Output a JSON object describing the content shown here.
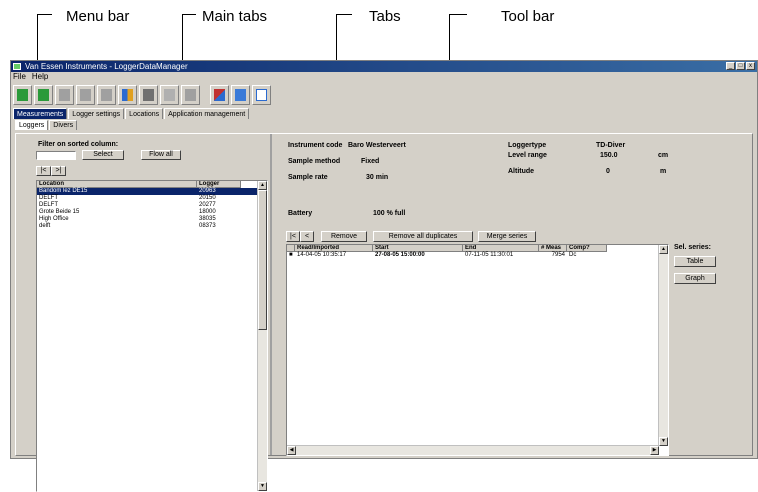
{
  "annotations": {
    "menu_bar": "Menu bar",
    "main_tabs": "Main tabs",
    "tabs": "Tabs",
    "tool_bar": "Tool bar"
  },
  "window": {
    "title": "Van Essen Instruments - LoggerDataManager",
    "min": "_",
    "max": "□",
    "close": "x"
  },
  "menu": {
    "items": [
      "File",
      "Help"
    ]
  },
  "toolbar": {
    "buttons": [
      {
        "icon": "connect-logger-icon",
        "color": "#2a9a3a"
      },
      {
        "icon": "logger-settings-icon",
        "color": "#2a9a3a"
      },
      {
        "icon": "chart-icon",
        "color": "#808080"
      },
      {
        "icon": "graph-icon",
        "color": "#808080"
      },
      {
        "icon": "compensate-icon",
        "color": "#808080"
      },
      {
        "icon": "export-icon",
        "color": "#2a6ad0"
      },
      {
        "icon": "table-icon",
        "color": "#606060"
      },
      {
        "icon": "thermometer-icon",
        "color": "#808080"
      },
      {
        "icon": "network-icon",
        "color": "#808080"
      },
      {
        "icon": "report-icon",
        "color": "#c03030"
      },
      {
        "icon": "list-icon",
        "color": "#2a6ad0"
      },
      {
        "icon": "calendar-icon",
        "color": "#2a6ad0"
      }
    ]
  },
  "main_tabs": [
    "Measurements",
    "Logger settings",
    "Locations",
    "Application management"
  ],
  "sub_tabs": [
    "Loggers",
    "Divers"
  ],
  "left": {
    "filter_label": "Filter on sorted column:",
    "select": "Select",
    "flow_all": "Flow all",
    "nav_first": "|<",
    "nav_next": ">|",
    "columns": [
      "Location",
      "Logger"
    ],
    "rows": [
      {
        "location": "Bandom lez DE15",
        "logger": "20963"
      },
      {
        "location": "DELFT",
        "logger": "20150"
      },
      {
        "location": "DELFT",
        "logger": "20277"
      },
      {
        "location": "Grote Beide 15",
        "logger": "18000"
      },
      {
        "location": "High Office",
        "logger": "38035"
      },
      {
        "location": "delft",
        "logger": "08373"
      }
    ]
  },
  "right": {
    "instrument_code_label": "Instrument code",
    "instrument_code": "Baro Westerveert",
    "logger_type_label": "Loggertype",
    "logger_type": "TD-Diver",
    "sample_method_label": "Sample method",
    "sample_method": "Fixed",
    "level_range_label": "Level range",
    "level_range": "150.0",
    "level_unit": "cm",
    "sample_rate_label": "Sample rate",
    "sample_rate": "30 min",
    "altitude_label": "Altitude",
    "altitude": "0",
    "altitude_unit": "m",
    "battery_label": "Battery",
    "battery": "100 % full",
    "nav_first": "|<",
    "nav_prev": "<",
    "remove": "Remove",
    "remove_duplicates": "Remove all duplicates",
    "merge_series": "Merge series",
    "sel_series_label": "Sel. series:",
    "table": "Table",
    "graph": "Graph",
    "columns": [
      "",
      "Read/Imported",
      "Start",
      "End",
      "# Meas",
      "Comp?"
    ],
    "rows": [
      {
        "mark": "■",
        "read": "14-04-05 10:35:17",
        "start": "27-08-05 15:00:00",
        "end": "07-11-05 11:30:01",
        "meas": "7954",
        "comp": "Dc"
      }
    ]
  }
}
